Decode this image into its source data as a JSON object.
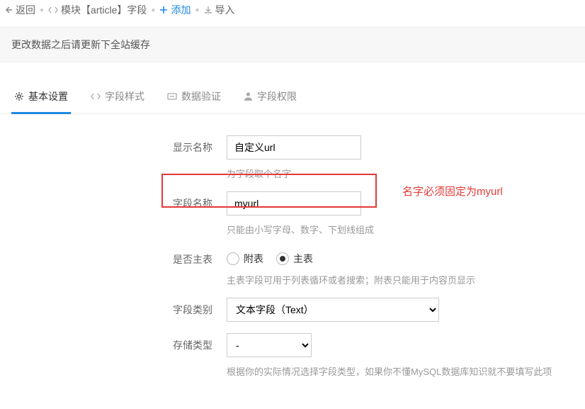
{
  "breadcrumb": {
    "back": "返回",
    "module": "模块【article】字段",
    "add": "添加",
    "import": "导入"
  },
  "notice": "更改数据之后请更新下全站缓存",
  "tabs": {
    "basic": "基本设置",
    "style": "字段样式",
    "validate": "数据验证",
    "permission": "字段权限"
  },
  "form": {
    "display_name": {
      "label": "显示名称",
      "value": "自定义url",
      "hint": "为字段取个名字"
    },
    "field_name": {
      "label": "字段名称",
      "value": "myurl",
      "hint": "只能由小写字母、数字、下划线组成"
    },
    "main_table": {
      "label": "是否主表",
      "opt_sub": "附表",
      "opt_main": "主表",
      "hint": "主表字段可用于列表循环或者搜索；附表只能用于内容页显示"
    },
    "field_type": {
      "label": "字段类别",
      "value": "文本字段（Text）"
    },
    "storage_type": {
      "label": "存储类型",
      "value": "-",
      "hint": "根据你的实际情况选择字段类型，如果你不懂MySQL数据库知识就不要填写此项"
    }
  },
  "annotation": "名字必须固定为myurl"
}
